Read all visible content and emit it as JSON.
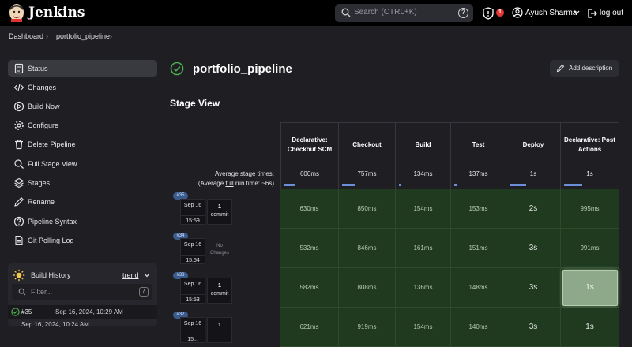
{
  "header": {
    "brand": "Jenkins",
    "search_placeholder": "Search (CTRL+K)",
    "help_symbol": "?",
    "security_count": "1",
    "user_name": "Ayush Sharma",
    "logout_label": "log out"
  },
  "breadcrumbs": [
    "Dashboard",
    "portfolio_pipeline"
  ],
  "sidebar": {
    "items": [
      {
        "label": "Status",
        "icon": "status-icon"
      },
      {
        "label": "Changes",
        "icon": "code-icon"
      },
      {
        "label": "Build Now",
        "icon": "play-icon"
      },
      {
        "label": "Configure",
        "icon": "gear-icon"
      },
      {
        "label": "Delete Pipeline",
        "icon": "trash-icon"
      },
      {
        "label": "Full Stage View",
        "icon": "search-icon"
      },
      {
        "label": "Stages",
        "icon": "layers-icon"
      },
      {
        "label": "Rename",
        "icon": "pencil-icon"
      },
      {
        "label": "Pipeline Syntax",
        "icon": "help-icon"
      },
      {
        "label": "Git Polling Log",
        "icon": "document-icon"
      }
    ]
  },
  "build_history": {
    "title": "Build History",
    "trend_label": "trend",
    "filter_placeholder": "Filter...",
    "filter_shortcut": "/",
    "latest_number": "#35",
    "latest_date": "Sep 16, 2024, 10:29 AM",
    "next_date": "Sep 16, 2024, 10:24 AM"
  },
  "main": {
    "title": "portfolio_pipeline",
    "add_description_label": "Add description",
    "stage_view_title": "Stage View",
    "avg_stage_times": "Average stage times:",
    "avg_full_prefix": "(Average ",
    "avg_full_link": "full",
    "avg_full_suffix": " run time: ~6s)"
  },
  "stages": [
    {
      "name": "Declarative: Checkout SCM",
      "avg": "600ms",
      "bar": 0.2
    },
    {
      "name": "Checkout",
      "avg": "757ms",
      "bar": 0.25
    },
    {
      "name": "Build",
      "avg": "134ms",
      "bar": 0.05
    },
    {
      "name": "Test",
      "avg": "137ms",
      "bar": 0.05
    },
    {
      "name": "Deploy",
      "avg": "1s",
      "bar": 0.35
    },
    {
      "name": "Declarative: Post Actions",
      "avg": "1s",
      "bar": 0.35
    }
  ],
  "runs": [
    {
      "tag": "#35",
      "date": "Sep 16",
      "time": "15:59",
      "changes_count": "1",
      "changes_label": "commit",
      "times": [
        "630ms",
        "850ms",
        "154ms",
        "153ms",
        "2s",
        "995ms"
      ]
    },
    {
      "tag": "#34",
      "date": "Sep 16",
      "time": "15:54",
      "no_changes_label": "No Changes",
      "times": [
        "532ms",
        "846ms",
        "161ms",
        "151ms",
        "3s",
        "991ms"
      ]
    },
    {
      "tag": "#33",
      "date": "Sep 16",
      "time": "15:53",
      "changes_count": "1",
      "changes_label": "commit",
      "times": [
        "582ms",
        "808ms",
        "136ms",
        "148ms",
        "3s",
        "1s"
      ]
    },
    {
      "tag": "#32",
      "date": "Sep 16",
      "time": "15:..",
      "changes_count": "1",
      "changes_label": "",
      "times": [
        "621ms",
        "919ms",
        "154ms",
        "140ms",
        "3s",
        "1s"
      ]
    }
  ],
  "colors": {
    "success": "#1f3a1f",
    "accent_bar": "#6a8fd6",
    "badge": "#e53935"
  }
}
